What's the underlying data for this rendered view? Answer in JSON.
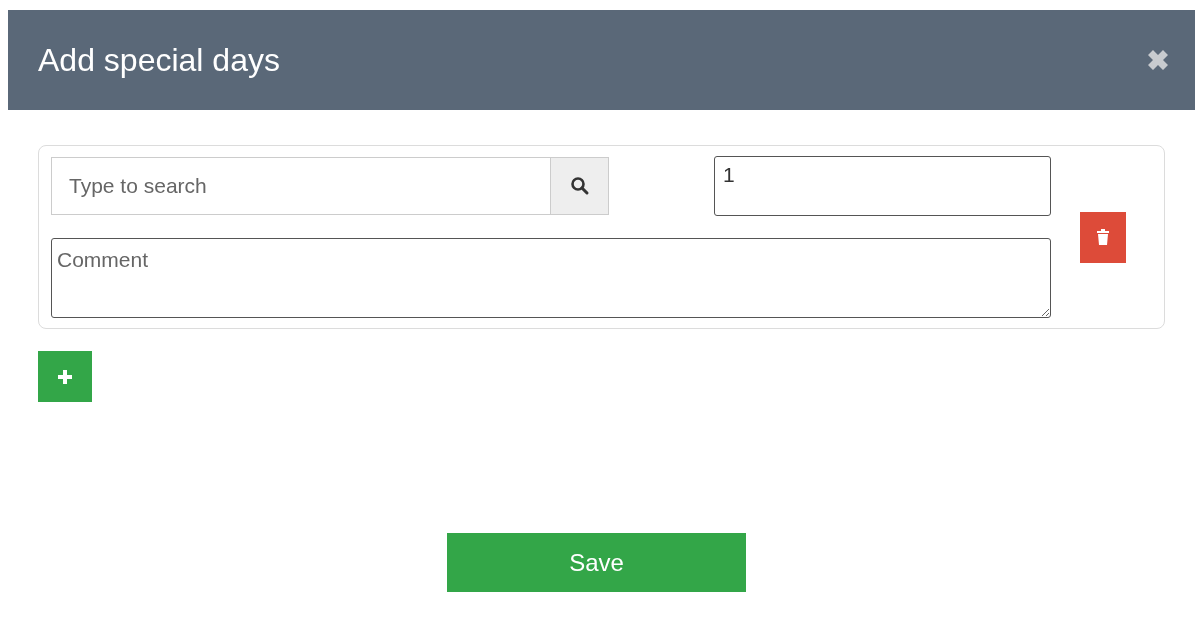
{
  "dialog": {
    "title": "Add special days"
  },
  "entries": [
    {
      "search": {
        "placeholder": "Type to search"
      },
      "quantity": {
        "value": "1"
      },
      "comment": {
        "placeholder": "Comment"
      }
    }
  ],
  "save_button": "Save"
}
